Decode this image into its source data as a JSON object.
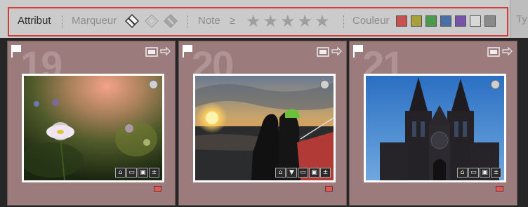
{
  "filter_bar": {
    "attribute_label": "Attribut",
    "flag_label": "Marqueur",
    "rating_label": "Note",
    "rating_operator": "≥",
    "rating_stars": 5,
    "color_label": "Couleur",
    "type_label": "Ty",
    "swatch_colors": [
      "#c8504d",
      "#a8a03a",
      "#4c9a4c",
      "#4a6fa8",
      "#7754a8",
      "#d8d8d8",
      "#8a8a8a"
    ],
    "outline_color": "#d23a36"
  },
  "thumbnails": [
    {
      "index": "19",
      "description": "daisy",
      "color_label": "red"
    },
    {
      "index": "20",
      "description": "sunset-boat",
      "color_label": "red"
    },
    {
      "index": "21",
      "description": "cathedral",
      "color_label": "red"
    }
  ],
  "badge_glyphs": {
    "keyword": "⌂",
    "crop": "▣",
    "stack": "▭",
    "develop": "±",
    "comment": "▼"
  }
}
